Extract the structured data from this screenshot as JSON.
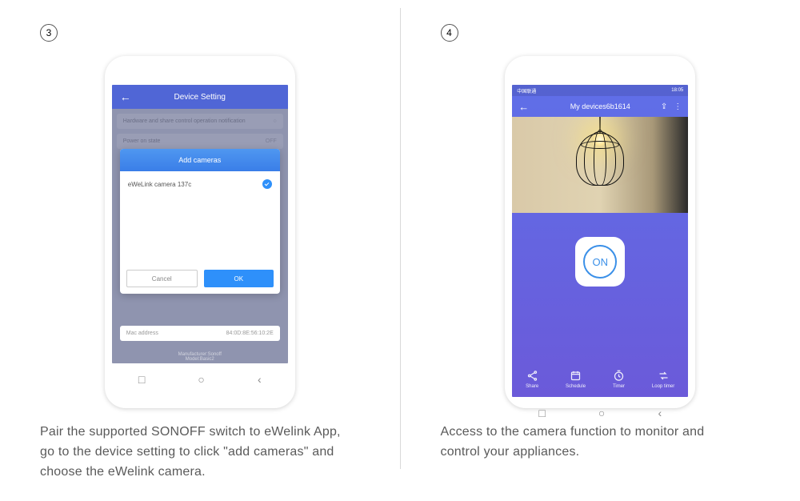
{
  "step3": {
    "num": "3",
    "caption": "Pair the supported SONOFF switch to eWelink App, go to the device setting to click \"add cameras\" and choose the eWelink camera.",
    "bar_title": "Device Setting",
    "bg_item1": "Hardware and share control operation notification",
    "bg_item2_label": "Power on state",
    "bg_item2_value": "OFF",
    "modal_title": "Add cameras",
    "camera_item": "eWeLink camera 137c",
    "cancel": "Cancel",
    "ok": "OK",
    "mac_label": "Mac address",
    "mac_value": "84:0D:8E:56:10:2E",
    "foot1": "Manufacturer:Sonoff",
    "foot2": "Model:Basic2",
    "nav": {
      "recent": "□",
      "home": "○",
      "back": "‹"
    }
  },
  "step4": {
    "num": "4",
    "caption": "Access to the camera function to monitor and control your appliances.",
    "carrier": "中国联通",
    "time": "18:05",
    "bar_title": "My devices6b1614",
    "on_label": "ON",
    "foot": {
      "share": "Share",
      "schedule": "Schedule",
      "timer": "Timer",
      "loop": "Loop timer"
    },
    "nav": {
      "recent": "□",
      "home": "○",
      "back": "‹"
    }
  }
}
